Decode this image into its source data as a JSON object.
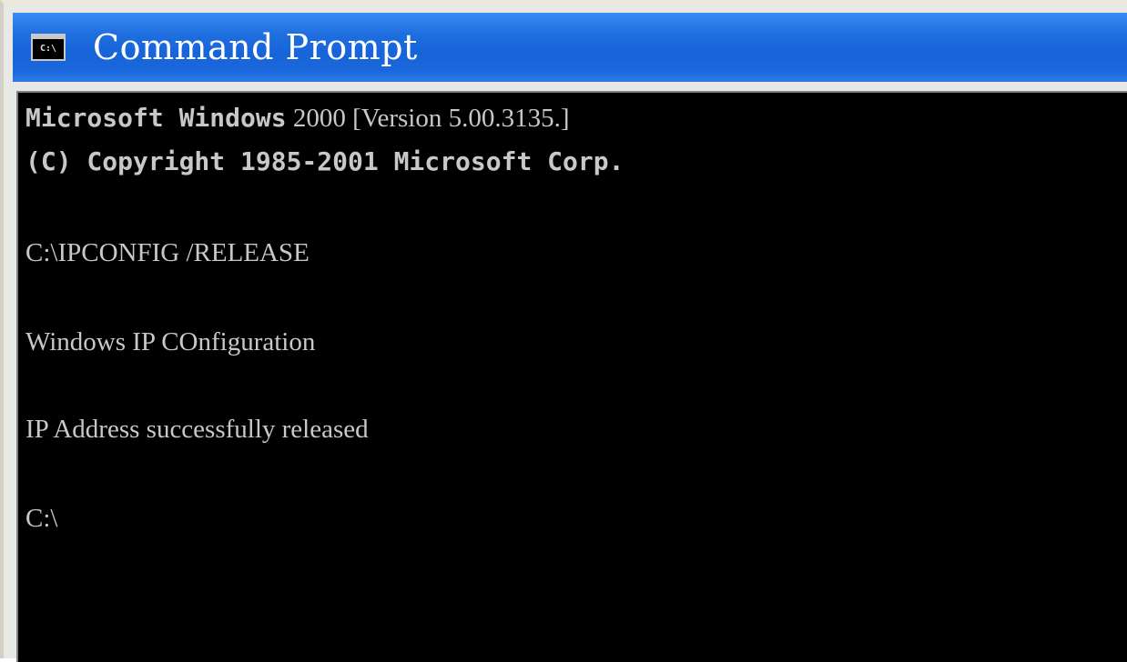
{
  "window": {
    "title": "Command Prompt",
    "icon": "console-icon",
    "icon_label": "C:\\"
  },
  "console": {
    "banner_product": "Microsoft Windows",
    "banner_version": " 2000 [Version 5.00.3135.]",
    "copyright": "(C) Copyright 1985-2001 Microsoft Corp.",
    "command": "C:\\IPCONFIG /RELEASE",
    "heading": "Windows IP COnfiguration",
    "message": "IP Address successfully released",
    "prompt": "C:\\"
  },
  "colors": {
    "titlebar": "#1763d8",
    "console_bg": "#000000",
    "console_text": "#c8c8c8",
    "title_text": "#ffffff"
  }
}
